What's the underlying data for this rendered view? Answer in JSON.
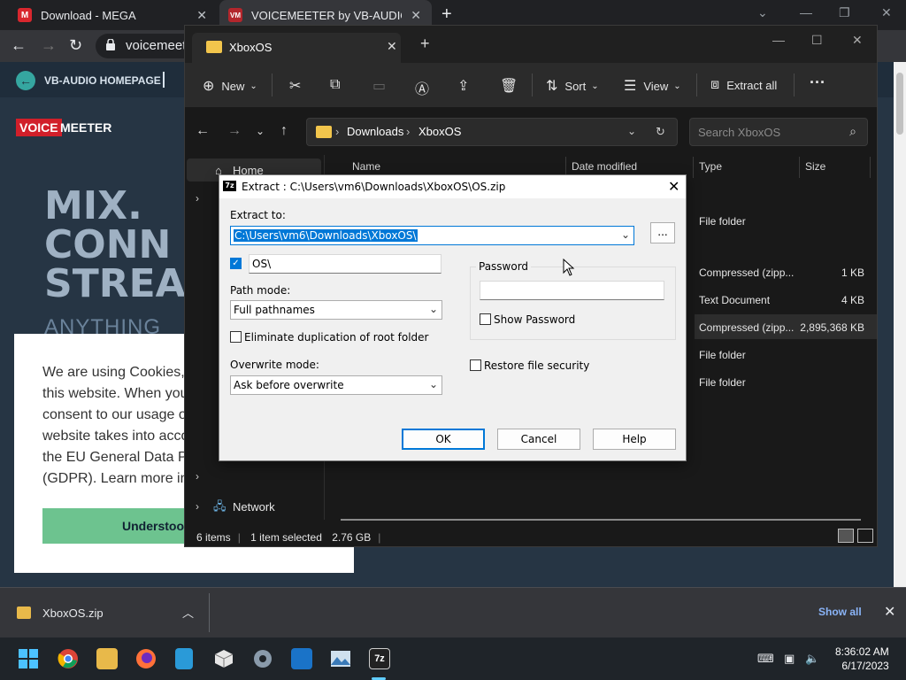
{
  "browser": {
    "tabs": [
      {
        "title": "Download - MEGA",
        "favicon_text": "M",
        "favicon_color": "#d9272e"
      },
      {
        "title": "VOICEMEETER by VB-AUDIO – Th",
        "favicon_text": "VM",
        "favicon_color": "#b3262c"
      }
    ],
    "url": "voicemeete"
  },
  "web": {
    "nav_home": "VB-AUDIO HOMEPAGE",
    "logo_voice": "VOICE",
    "logo_meeter": "MEETER",
    "hero_lines": [
      "MIX.",
      "CONN",
      "STREA"
    ],
    "hero_sub": "ANYTHING",
    "cookie_lines": [
      "We are using Cookies,",
      "this website. When you",
      "consent to our usage o",
      "website takes into acco",
      "the EU General Data P",
      "(GDPR). Learn more in"
    ],
    "cookie_button": "Understoo"
  },
  "download_bar": {
    "file": "XboxOS.zip",
    "show_all": "Show all"
  },
  "taskbar": {
    "time": "8:36:02 AM",
    "date": "6/17/2023"
  },
  "explorer": {
    "tab_title": "XboxOS",
    "toolbar": {
      "new": "New",
      "sort": "Sort",
      "view": "View",
      "extract_all": "Extract all"
    },
    "breadcrumb": [
      "Downloads",
      "XboxOS"
    ],
    "search_placeholder": "Search XboxOS",
    "nav": {
      "home": "Home",
      "network": "Network"
    },
    "columns": {
      "name": "Name",
      "date": "Date modified",
      "type": "Type",
      "size": "Size"
    },
    "rows": [
      {
        "type": "File folder",
        "size": ""
      },
      {
        "type": "Compressed (zipp...",
        "size": "1 KB"
      },
      {
        "type": "Text Document",
        "size": "4 KB"
      },
      {
        "type": "Compressed (zipp...",
        "size": "2,895,368 KB"
      },
      {
        "type": "File folder",
        "size": ""
      },
      {
        "type": "File folder",
        "size": ""
      }
    ],
    "status": {
      "items": "6 items",
      "selected": "1 item selected",
      "size": "2.76 GB"
    }
  },
  "dialog": {
    "icon_text": "7z",
    "title": "Extract : C:\\Users\\vm6\\Downloads\\XboxOS\\OS.zip",
    "extract_to_label": "Extract to:",
    "extract_to_value": "C:\\Users\\vm6\\Downloads\\XboxOS\\",
    "browse_label": "...",
    "subfolder_value": "OS\\",
    "path_mode_label": "Path mode:",
    "path_mode_value": "Full pathnames",
    "eliminate_dup_label": "Eliminate duplication of root folder",
    "overwrite_mode_label": "Overwrite mode:",
    "overwrite_mode_value": "Ask before overwrite",
    "password_label": "Password",
    "show_password_label": "Show Password",
    "restore_security_label": "Restore file security",
    "ok": "OK",
    "cancel": "Cancel",
    "help": "Help"
  }
}
